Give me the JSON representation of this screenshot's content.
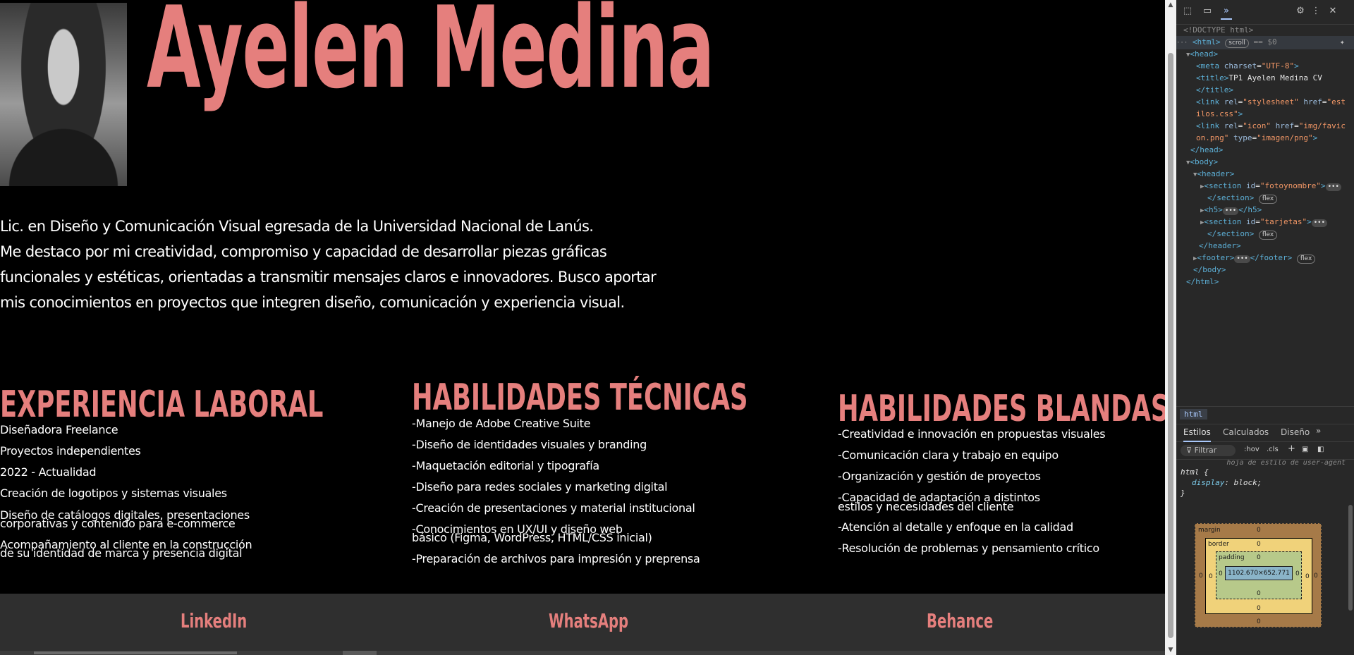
{
  "page": {
    "name": "Ayelen Medina",
    "bio": [
      "Lic. en Diseño y Comunicación Visual egresada de la Universidad Nacional de Lanús.",
      "Me destaco por mi creatividad, compromiso y capacidad de desarrollar piezas gráficas",
      "funcionales y estéticas, orientadas a transmitir mensajes claros e innovadores. Busco aportar",
      "mis conocimientos en proyectos que integren diseño, comunicación y experiencia visual."
    ],
    "columns": {
      "experiencia": {
        "title": "EXPERIENCIA LABORAL",
        "items": [
          "Diseñadora Freelance",
          "Proyectos independientes",
          "2022 - Actualidad",
          "Creación de logotipos y sistemas visuales",
          "Diseño de catálogos digitales, presentaciones",
          "corporativas y contenido para e-commerce",
          "Acompañamiento al cliente en la construcción",
          "de su identidad de marca y presencia digital"
        ]
      },
      "tecnicas": {
        "title": "HABILIDADES TÉCNICAS",
        "items": [
          "-Manejo de Adobe Creative Suite",
          "-Diseño de identidades visuales y branding",
          "-Maquetación editorial y tipografía",
          "-Diseño para redes sociales y marketing digital",
          "-Creación de presentaciones y material institucional",
          "-Conocimientos en UX/UI y diseño web",
          "básico (Figma, WordPress, HTML/CSS inicial)",
          "-Preparación de archivos para impresión y preprensa"
        ]
      },
      "blandas": {
        "title": "HABILIDADES BLANDAS",
        "items": [
          "-Creatividad e innovación en propuestas visuales",
          "-Comunicación clara y trabajo en equipo",
          "-Organización y gestión de proyectos",
          "-Capacidad de adaptación a distintos",
          "estilos y necesidades del cliente",
          "-Atención al detalle y enfoque en la calidad",
          "-Resolución de problemas y pensamiento crítico"
        ]
      }
    },
    "footer": {
      "linkedin": "LinkedIn",
      "whatsapp": "WhatsApp",
      "behance": "Behance"
    }
  },
  "colors": {
    "accent": "#e57f7d",
    "background": "#000000",
    "footer_bg": "#2f2f2f",
    "text": "#ffffff"
  },
  "devtools": {
    "dom": {
      "doctype": "<!DOCTYPE html>",
      "html_tag": "<html>",
      "scroll_badge": "scroll",
      "dollar": "== $0",
      "head": "<head>",
      "meta_tag": "<meta",
      "meta_attr": "charset",
      "meta_val": "\"UTF-8\"",
      "title_open": "<title>",
      "title_text": "TP1 Ayelen Medina CV",
      "title_close": "</title>",
      "link1_tag": "<link",
      "link1_rel": "rel",
      "link1_rel_val": "\"stylesheet\"",
      "link1_href": "href",
      "link1_href_val_a": "\"est",
      "link1_href_val_b": "ilos.css\"",
      "link2_tag": "<link",
      "link2_rel": "rel",
      "link2_rel_val": "\"icon\"",
      "link2_href": "href",
      "link2_href_val_a": "\"img/favic",
      "link2_href_val_b": "on.png\"",
      "link2_type": "type",
      "link2_type_val": "\"imagen/png\"",
      "head_close": "</head>",
      "body": "<body>",
      "header": "<header>",
      "section1_tag": "<section",
      "section1_attr": "id",
      "section1_val": "\"fotoynombre\"",
      "section_close": "</section>",
      "flex_badge": "flex",
      "h5_open": "<h5>",
      "h5_close": "</h5>",
      "section2_val": "\"tarjetas\"",
      "header_close": "</header>",
      "footer_open": "<footer>",
      "footer_close": "</footer>",
      "body_close": "</body>",
      "html_close": "</html>",
      "ellipsis": "•••"
    },
    "breadcrumb": "html",
    "tabs": [
      "Estilos",
      "Calculados",
      "Diseño"
    ],
    "filter_placeholder": "Filtrar",
    "hov": ":hov",
    "cls": ".cls",
    "styles": {
      "source": "hoja de estilo de user-agent",
      "selector": "html {",
      "property": "display",
      "value": "block;",
      "close": "}"
    },
    "boxmodel": {
      "margin_label": "margin",
      "border_label": "border",
      "padding_label": "padding",
      "content_size": "1102.670×652.771",
      "zero": "0"
    }
  }
}
